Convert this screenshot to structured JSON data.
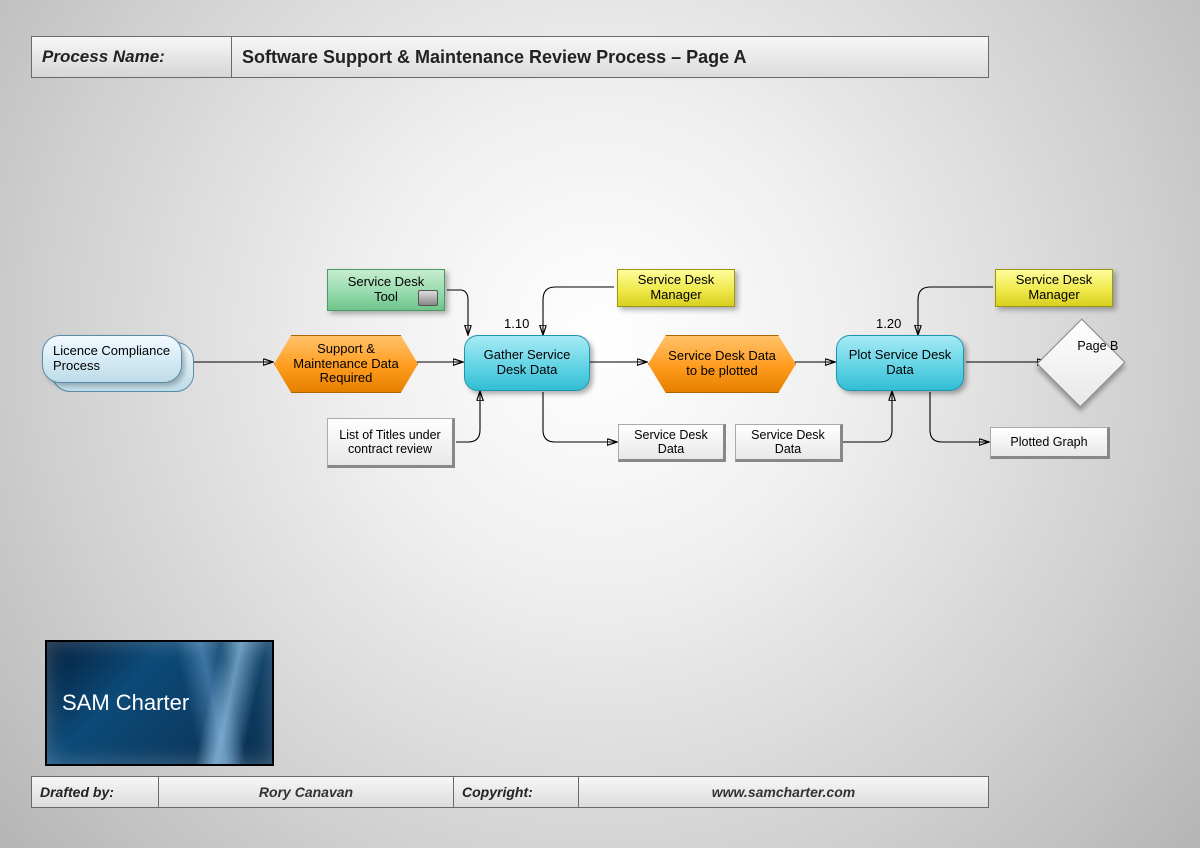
{
  "header": {
    "label": "Process Name:",
    "value": "Software Support & Maintenance Review Process – Page A"
  },
  "footer": {
    "draftedByLabel": "Drafted by:",
    "draftedByValue": "Rory Canavan",
    "copyrightLabel": "Copyright:",
    "copyrightValue": "www.samcharter.com"
  },
  "logo": "SAM Charter",
  "nums": {
    "n1": "1.10",
    "n2": "1.20"
  },
  "nodes": {
    "start": "Licence Compliance Process",
    "hex1": "Support & Maintenance Data Required",
    "roleGreen": "Service Desk Tool",
    "task1": "Gather Service Desk Data",
    "dataList": "List of Titles under contract review",
    "roleY1": "Service Desk Manager",
    "hex2": "Service Desk Data to be plotted",
    "dataSD1": "Service Desk Data",
    "dataSD2": "Service Desk Data",
    "task2": "Plot Service Desk Data",
    "roleY2": "Service Desk Manager",
    "pageB": "Page B",
    "dataPlot": "Plotted Graph"
  }
}
